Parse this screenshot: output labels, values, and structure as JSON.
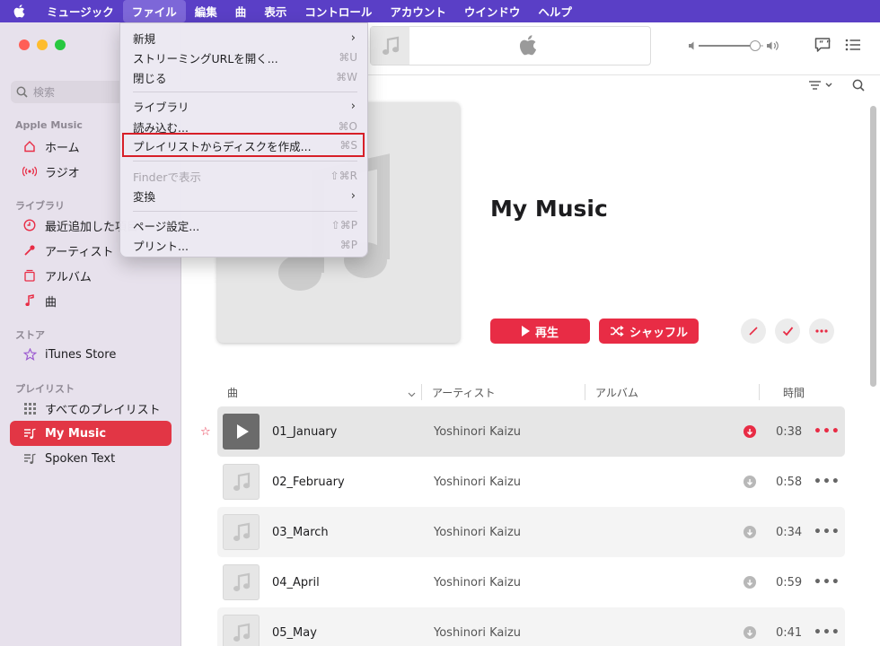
{
  "menubar": {
    "apple_icon": "apple-logo",
    "items": [
      "ミュージック",
      "ファイル",
      "編集",
      "曲",
      "表示",
      "コントロール",
      "アカウント",
      "ウインドウ",
      "ヘルプ"
    ]
  },
  "sidebar": {
    "search_placeholder": "検索",
    "sections": {
      "apple_music": "Apple Music",
      "library": "ライブラリ",
      "store": "ストア",
      "playlists": "プレイリスト"
    },
    "apple_music_items": [
      {
        "label": "ホーム",
        "icon": "home-icon"
      },
      {
        "label": "ラジオ",
        "icon": "radio-icon"
      }
    ],
    "library_items": [
      {
        "label": "最近追加した項目",
        "icon": "clock-icon"
      },
      {
        "label": "アーティスト",
        "icon": "microphone-icon"
      },
      {
        "label": "アルバム",
        "icon": "album-icon"
      },
      {
        "label": "曲",
        "icon": "note-icon"
      }
    ],
    "store_items": [
      {
        "label": "iTunes Store",
        "icon": "star-icon"
      }
    ],
    "playlist_items": [
      {
        "label": "すべてのプレイリスト",
        "icon": "grid-icon"
      },
      {
        "label": "My Music",
        "icon": "playlist-icon",
        "selected": true
      },
      {
        "label": "Spoken Text",
        "icon": "playlist-icon"
      }
    ]
  },
  "playlist": {
    "title": "My Music",
    "play_label": "再生",
    "shuffle_label": "シャッフル"
  },
  "table": {
    "headers": {
      "song": "曲",
      "artist": "アーティスト",
      "album": "アルバム",
      "time": "時間"
    },
    "rows": [
      {
        "song": "01_January",
        "artist": "Yoshinori Kaizu",
        "time": "0:38"
      },
      {
        "song": "02_February",
        "artist": "Yoshinori Kaizu",
        "time": "0:58"
      },
      {
        "song": "03_March",
        "artist": "Yoshinori Kaizu",
        "time": "0:34"
      },
      {
        "song": "04_April",
        "artist": "Yoshinori Kaizu",
        "time": "0:59"
      },
      {
        "song": "05_May",
        "artist": "Yoshinori Kaizu",
        "time": "0:41"
      }
    ]
  },
  "file_menu": {
    "items": [
      {
        "label": "新規",
        "shortcut": "",
        "submenu": true
      },
      {
        "label": "ストリーミングURLを開く...",
        "shortcut": "⌘U"
      },
      {
        "label": "閉じる",
        "shortcut": "⌘W"
      },
      {
        "label": "ライブラリ",
        "shortcut": "",
        "submenu": true
      },
      {
        "label": "読み込む...",
        "shortcut": "⌘O"
      },
      {
        "label": "プレイリストからディスクを作成...",
        "shortcut": "⌘S"
      },
      {
        "label": "Finderで表示",
        "shortcut": "⇧⌘R",
        "disabled": true
      },
      {
        "label": "変換",
        "shortcut": "",
        "submenu": true
      },
      {
        "label": "ページ設定...",
        "shortcut": "⇧⌘P"
      },
      {
        "label": "プリント...",
        "shortcut": "⌘P"
      }
    ]
  },
  "colors": {
    "accent": "#e82c45",
    "menubar": "#5a3fc6",
    "highlight_box": "#d71f28"
  }
}
